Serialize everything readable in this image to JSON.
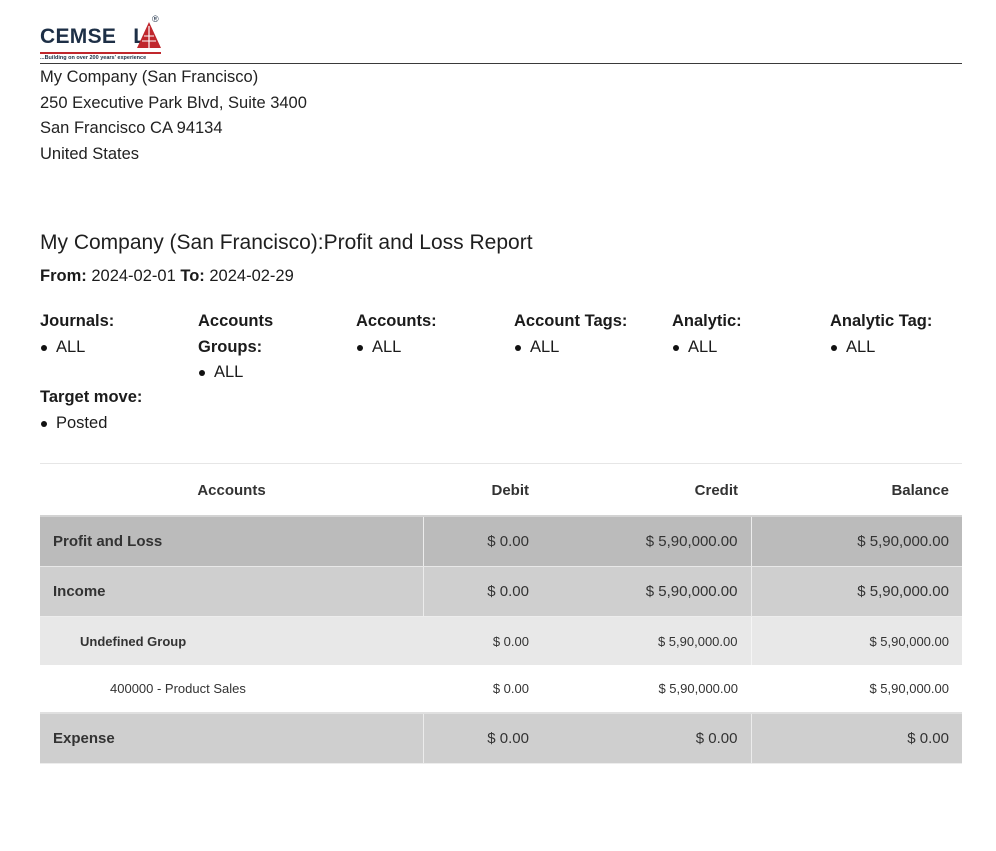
{
  "logo": {
    "text_left": "CEMSE",
    "text_right": "L",
    "tagline": "...Building on over 200 years' experience",
    "registered": "®",
    "brand_color": "#1d2f46",
    "accent_color": "#c0272d"
  },
  "company": {
    "name": "My Company (San Francisco)",
    "street": "250 Executive Park Blvd, Suite 3400",
    "city": "San Francisco CA 94134",
    "country": "United States"
  },
  "report": {
    "title": "My Company (San Francisco):Profit and Loss Report",
    "from_label": "From:",
    "from_date": "2024-02-01",
    "to_label": "To:",
    "to_date": "2024-02-29"
  },
  "filters": [
    {
      "label": "Journals:",
      "value": "ALL"
    },
    {
      "label": "Accounts\nGroups:",
      "value": "ALL"
    },
    {
      "label": "Accounts:",
      "value": "ALL"
    },
    {
      "label": "Account Tags:",
      "value": "ALL"
    },
    {
      "label": "Analytic:",
      "value": "ALL"
    },
    {
      "label": "Analytic Tag:",
      "value": "ALL"
    },
    {
      "label": "Target move:",
      "value": "Posted"
    }
  ],
  "table": {
    "headers": {
      "accounts": "Accounts",
      "debit": "Debit",
      "credit": "Credit",
      "balance": "Balance"
    },
    "rows": [
      {
        "name": "Profit and Loss",
        "debit": "$ 0.00",
        "credit": "$ 5,90,000.00",
        "balance": "$ 5,90,000.00"
      },
      {
        "name": "Income",
        "debit": "$ 0.00",
        "credit": "$ 5,90,000.00",
        "balance": "$ 5,90,000.00"
      },
      {
        "name": "Undefined Group",
        "debit": "$ 0.00",
        "credit": "$ 5,90,000.00",
        "balance": "$ 5,90,000.00"
      },
      {
        "name": "400000 - Product Sales",
        "debit": "$ 0.00",
        "credit": "$ 5,90,000.00",
        "balance": "$ 5,90,000.00"
      },
      {
        "name": "Expense",
        "debit": "$ 0.00",
        "credit": "$ 0.00",
        "balance": "$ 0.00"
      }
    ]
  }
}
